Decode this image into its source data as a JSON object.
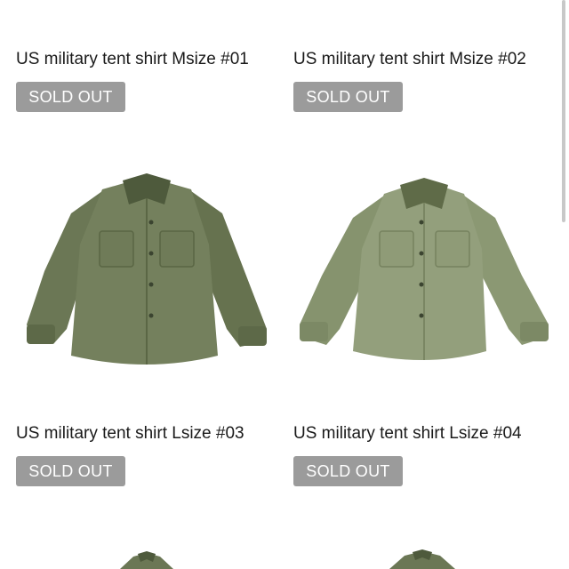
{
  "products": [
    {
      "title": "US military tent shirt Msize #01",
      "status": "SOLD OUT"
    },
    {
      "title": "US military tent shirt Msize #02",
      "status": "SOLD OUT"
    },
    {
      "title": "US military tent shirt Lsize #03",
      "status": "SOLD OUT"
    },
    {
      "title": "US military tent shirt Lsize #04",
      "status": "SOLD OUT"
    }
  ],
  "colors": {
    "badge": "#9b9b9b",
    "shirt_dark": "#6b7755",
    "shirt_light": "#8d9a76"
  }
}
